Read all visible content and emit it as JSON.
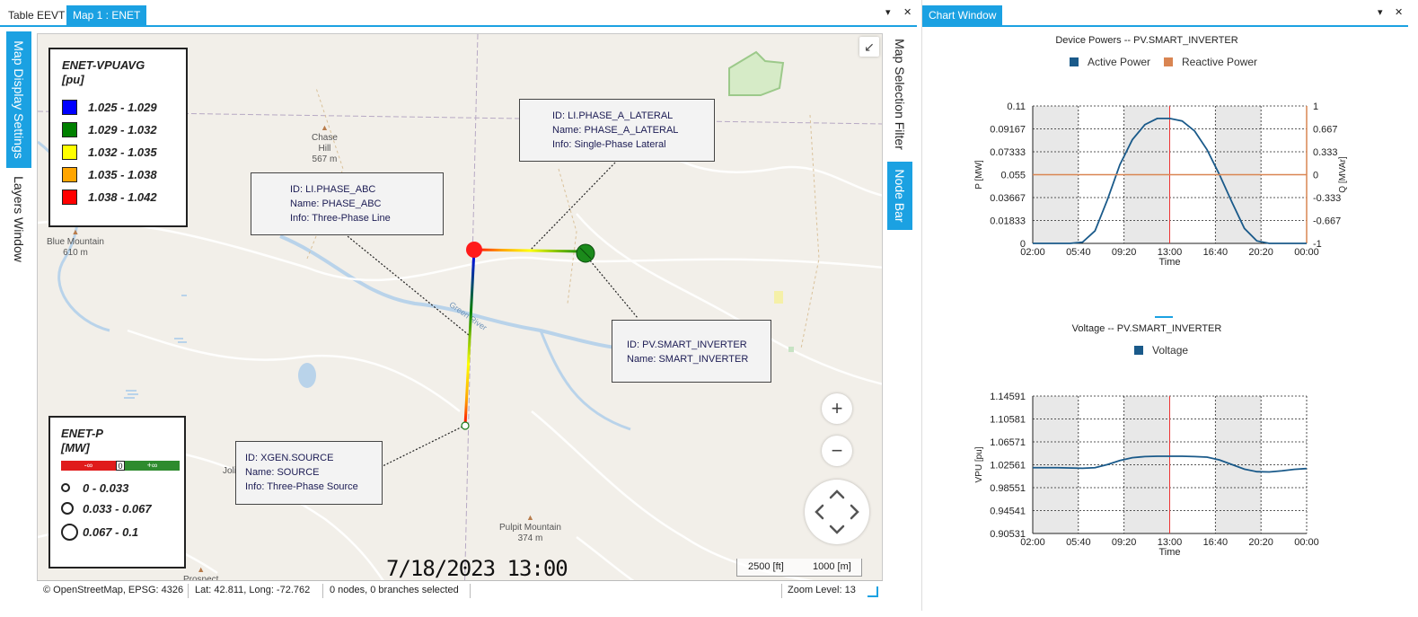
{
  "tabs": {
    "left": [
      {
        "label": "Table EEVT",
        "active": false
      },
      {
        "label": "Map 1 : ENET",
        "active": true
      }
    ],
    "right": [
      {
        "label": "Chart Window",
        "active": true
      }
    ],
    "pin_glyph": "▾",
    "close_glyph": "✕"
  },
  "side_tabs": {
    "left": [
      "Map Display Settings",
      "Layers Window"
    ],
    "right": [
      "Map Selection Filter",
      "Node Bar"
    ]
  },
  "voltage_legend": {
    "title_line1": "ENET-VPUAVG",
    "title_line2": "[pu]",
    "items": [
      {
        "label": "1.025 - 1.029",
        "color": "#0000ff"
      },
      {
        "label": "1.029 - 1.032",
        "color": "#008000"
      },
      {
        "label": "1.032 - 1.035",
        "color": "#ffff00"
      },
      {
        "label": "1.035 - 1.038",
        "color": "#ffa500"
      },
      {
        "label": "1.038 - 1.042",
        "color": "#ff0000"
      }
    ]
  },
  "power_legend": {
    "title_line1": "ENET-P",
    "title_line2": "[MW]",
    "bar_neg": "-∞",
    "bar_zero": "0",
    "bar_pos": "+∞",
    "items": [
      {
        "label": "0 - 0.033"
      },
      {
        "label": "0.033 - 0.067"
      },
      {
        "label": "0.067 - 0.1"
      }
    ]
  },
  "tooltips": {
    "lateral": {
      "id": "ID: LI.PHASE_A_LATERAL",
      "name": "Name: PHASE_A_LATERAL",
      "info": "Info: Single-Phase Lateral"
    },
    "abc": {
      "id": "ID: LI.PHASE_ABC",
      "name": "Name: PHASE_ABC",
      "info": "Info: Three-Phase Line"
    },
    "inverter": {
      "id": "ID: PV.SMART_INVERTER",
      "name": "Name: SMART_INVERTER"
    },
    "source": {
      "id": "ID: XGEN.SOURCE",
      "name": "Name: SOURCE",
      "info": "Info: Three-Phase Source"
    }
  },
  "places": [
    {
      "name": "Chase",
      "name2": "Hill",
      "elev": "567 m"
    },
    {
      "name": "Blue Mountain",
      "elev": "610 m"
    },
    {
      "name": "Pulpit Mountain",
      "elev": "374 m"
    },
    {
      "name": "Prospect"
    },
    {
      "name": "Joli"
    },
    {
      "name": "Green River"
    }
  ],
  "map_controls": {
    "zoom_in": "+",
    "zoom_out": "−",
    "collapse": "↙"
  },
  "datestamp": "7/18/2023 13:00",
  "scale": {
    "ft": "2500 [ft]",
    "m": "1000 [m]"
  },
  "status": {
    "attribution": "© OpenStreetMap,  EPSG: 4326",
    "coords": "Lat: 42.811, Long: -72.762",
    "selection": "0 nodes, 0 branches selected",
    "zoom": "Zoom Level: 13"
  },
  "charts": {
    "powers_title": "Device Powers -- PV.SMART_INVERTER",
    "voltage_title": "Voltage -- PV.SMART_INVERTER",
    "legend_active": "Active Power",
    "legend_reactive": "Reactive Power",
    "legend_voltage": "Voltage",
    "colors": {
      "active": "#1a5a8a",
      "reactive": "#d98552",
      "voltage": "#1a5a8a",
      "accent": "#1ba1e2"
    }
  },
  "chart_data": [
    {
      "type": "line",
      "title": "Device Powers -- PV.SMART_INVERTER",
      "xlabel": "Time",
      "ylabel": "P [MW]",
      "y2label": "Q [MVAr]",
      "x_ticks": [
        "02:00",
        "05:40",
        "09:20",
        "13:00",
        "16:40",
        "20:20",
        "00:00"
      ],
      "y_ticks": [
        "0",
        "0.01833",
        "0.03667",
        "0.055",
        "0.07333",
        "0.09167",
        "0.11"
      ],
      "y2_ticks": [
        "-1",
        "-0.667",
        "-0.333",
        "0",
        "0.333",
        "0.667",
        "1"
      ],
      "ylim": [
        0,
        0.11
      ],
      "y2lim": [
        -1,
        1
      ],
      "grid": true,
      "legend": "top",
      "series": [
        {
          "name": "Active Power",
          "x": [
            2,
            3,
            4,
            5,
            6,
            7,
            8,
            9,
            10,
            11,
            12,
            13,
            14,
            15,
            16,
            17,
            18,
            19,
            20,
            21,
            22,
            23,
            24
          ],
          "values": [
            0,
            0,
            0,
            0,
            0.001,
            0.01,
            0.035,
            0.063,
            0.083,
            0.095,
            0.1,
            0.1,
            0.098,
            0.09,
            0.075,
            0.055,
            0.033,
            0.012,
            0.002,
            0,
            0,
            0,
            0
          ]
        },
        {
          "name": "Reactive Power",
          "x": [
            2,
            24
          ],
          "values": [
            0,
            0
          ]
        }
      ]
    },
    {
      "type": "line",
      "title": "Voltage -- PV.SMART_INVERTER",
      "xlabel": "Time",
      "ylabel": "VPU [pu]",
      "x_ticks": [
        "02:00",
        "05:40",
        "09:20",
        "13:00",
        "16:40",
        "20:20",
        "00:00"
      ],
      "y_ticks": [
        "0.90531",
        "0.94541",
        "0.98551",
        "1.02561",
        "1.06571",
        "1.10581",
        "1.14591"
      ],
      "ylim": [
        0.90531,
        1.14591
      ],
      "grid": true,
      "legend": "top",
      "series": [
        {
          "name": "Voltage",
          "x": [
            2,
            4,
            6,
            7,
            8,
            9,
            10,
            11,
            12,
            13,
            14,
            15,
            16,
            17,
            18,
            19,
            20,
            21,
            22,
            23,
            24
          ],
          "values": [
            1.0205,
            1.0205,
            1.0195,
            1.0205,
            1.026,
            1.033,
            1.038,
            1.04,
            1.0405,
            1.0405,
            1.0405,
            1.04,
            1.039,
            1.034,
            1.026,
            1.018,
            1.0135,
            1.013,
            1.015,
            1.0175,
            1.019
          ]
        }
      ]
    }
  ]
}
